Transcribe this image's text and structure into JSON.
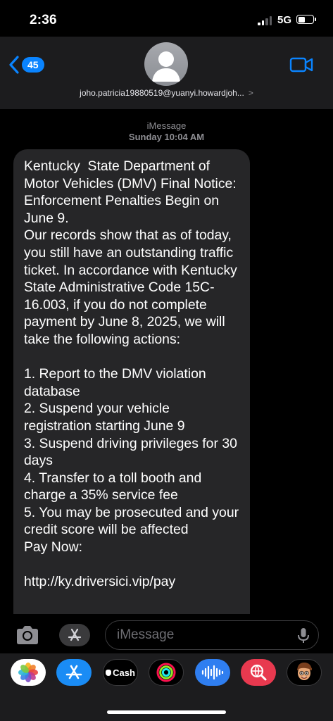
{
  "status_bar": {
    "time": "2:36",
    "network": "5G"
  },
  "header": {
    "back_count": "45",
    "contact": "joho.patricia19880519@yuanyi.howardjoh...",
    "contact_chevron": ">"
  },
  "thread": {
    "service": "iMessage",
    "timestamp": "Sunday 10:04 AM",
    "message": "Kentucky  State Department of Motor Vehicles (DMV) Final Notice: Enforcement Penalties Begin on June 9.\nOur records show that as of today, you still have an outstanding traffic ticket. In accordance with Kentucky State Administrative Code 15C-16.003, if you do not complete payment by June 8, 2025, we will take the following actions:\n\n1. Report to the DMV violation database\n2. Suspend your vehicle registration starting June 9\n3. Suspend driving privileges for 30 days\n4. Transfer to a toll booth and charge a 35% service fee\n5. You may be prosecuted and your credit score will be affected\nPay Now:\n\nhttp://ky.driversici.vip/pay"
  },
  "compose": {
    "placeholder": "iMessage"
  },
  "app_drawer": {
    "apps": [
      {
        "name": "photos-app-icon"
      },
      {
        "name": "app-store-icon"
      },
      {
        "name": "apple-cash-icon",
        "label": "Cash"
      },
      {
        "name": "fitness-app-icon"
      },
      {
        "name": "audio-message-icon"
      },
      {
        "name": "image-search-icon"
      },
      {
        "name": "memoji-icon"
      }
    ]
  },
  "colors": {
    "accent": "#0a84ff",
    "bubble": "#262628",
    "header": "#1c1c1e"
  }
}
